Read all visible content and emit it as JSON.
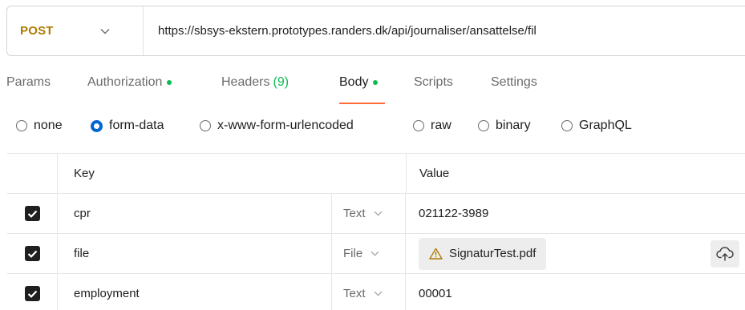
{
  "request": {
    "method": "POST",
    "url": "https://sbsys-ekstern.prototypes.randers.dk/api/journaliser/ansattelse/fil"
  },
  "tabs": [
    {
      "label": "Params",
      "dot": false
    },
    {
      "label": "Authorization",
      "dot": true
    },
    {
      "label": "Headers",
      "count": "(9)"
    },
    {
      "label": "Body",
      "dot": true,
      "active": true
    },
    {
      "label": "Scripts"
    },
    {
      "label": "Settings"
    }
  ],
  "body_types": [
    {
      "label": "none",
      "checked": false
    },
    {
      "label": "form-data",
      "checked": true
    },
    {
      "label": "x-www-form-urlencoded",
      "checked": false
    },
    {
      "label": "raw",
      "checked": false
    },
    {
      "label": "binary",
      "checked": false
    },
    {
      "label": "GraphQL",
      "checked": false
    }
  ],
  "table": {
    "headers": {
      "key": "Key",
      "value": "Value"
    },
    "rows": [
      {
        "checked": true,
        "key": "cpr",
        "type": "Text",
        "value": "021122-3989"
      },
      {
        "checked": true,
        "key": "file",
        "type": "File",
        "value": "SignaturTest.pdf"
      },
      {
        "checked": true,
        "key": "employment",
        "type": "Text",
        "value": "00001"
      }
    ]
  },
  "colors": {
    "method": "#ad7a03",
    "dot": "#0cbb52",
    "active_underline": "#ff6c37",
    "radio_checked": "#0265d2",
    "warning": "#b07d00"
  }
}
